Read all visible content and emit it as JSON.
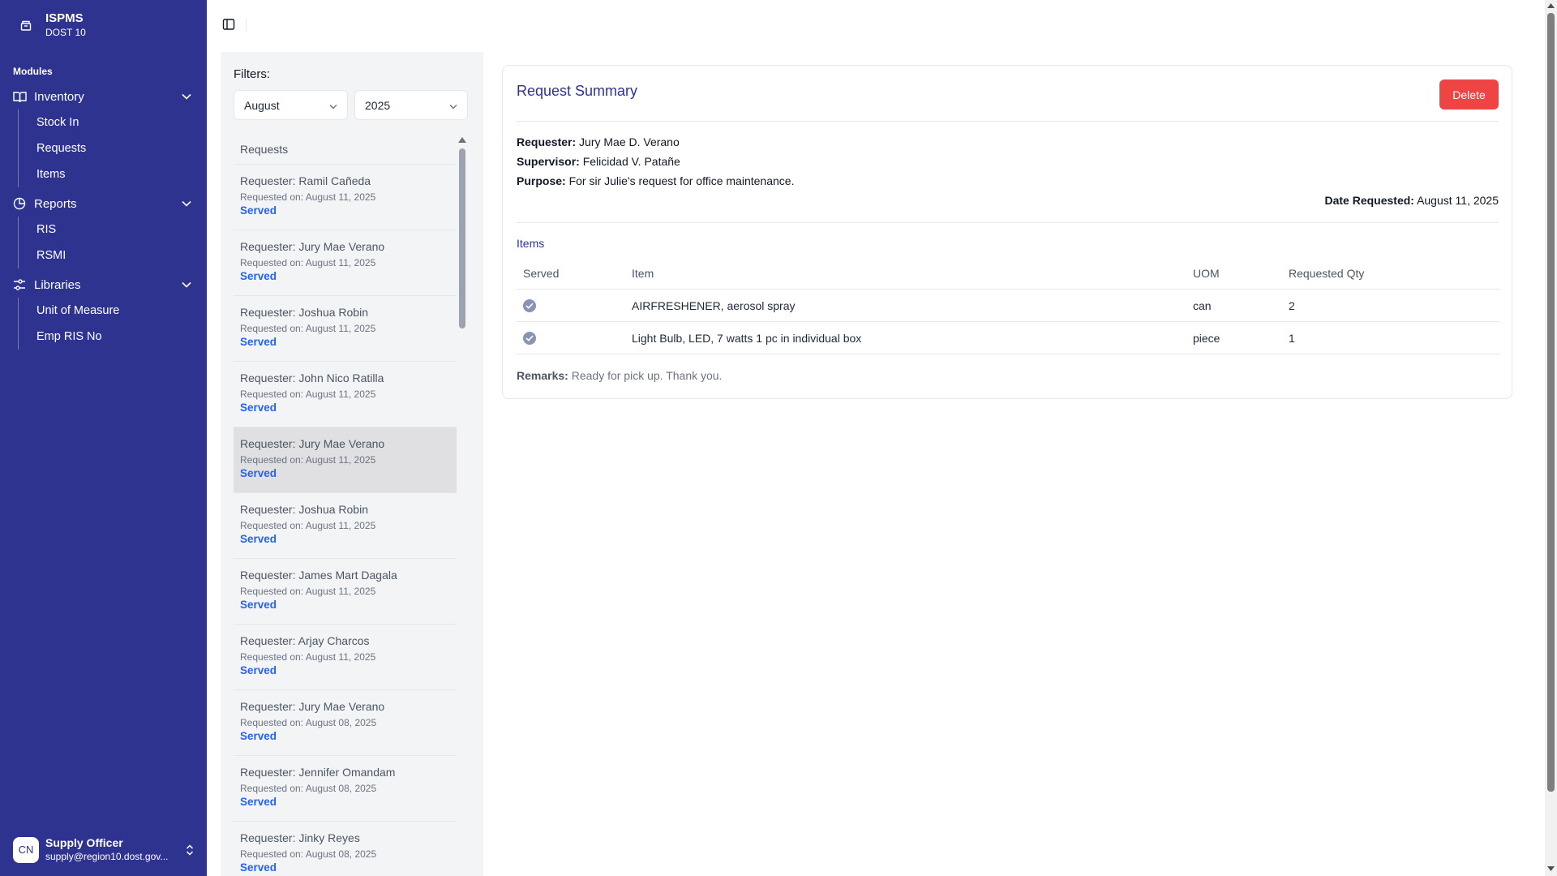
{
  "brand": {
    "title": "ISPMS",
    "subtitle": "DOST 10"
  },
  "sidebar": {
    "modules_label": "Modules",
    "groups": [
      {
        "label": "Inventory",
        "icon": "book-icon",
        "items": [
          "Stock In",
          "Requests",
          "Items"
        ]
      },
      {
        "label": "Reports",
        "icon": "pie-chart-icon",
        "items": [
          "RIS",
          "RSMI"
        ]
      },
      {
        "label": "Libraries",
        "icon": "sliders-icon",
        "items": [
          "Unit of Measure",
          "Emp RIS No"
        ]
      }
    ]
  },
  "user": {
    "initials": "CN",
    "name": "Supply Officer",
    "email": "supply@region10.dost.gov..."
  },
  "filters": {
    "label": "Filters:",
    "month": "August",
    "year": "2025"
  },
  "requests": {
    "header": "Requests",
    "items": [
      {
        "requester": "Requester: Ramil Cañeda",
        "date": "Requested on: August 11, 2025",
        "status": "Served"
      },
      {
        "requester": "Requester: Jury Mae Verano",
        "date": "Requested on: August 11, 2025",
        "status": "Served"
      },
      {
        "requester": "Requester: Joshua Robin",
        "date": "Requested on: August 11, 2025",
        "status": "Served"
      },
      {
        "requester": "Requester: John Nico Ratilla",
        "date": "Requested on: August 11, 2025",
        "status": "Served"
      },
      {
        "requester": "Requester: Jury Mae Verano",
        "date": "Requested on: August 11, 2025",
        "status": "Served"
      },
      {
        "requester": "Requester: Joshua Robin",
        "date": "Requested on: August 11, 2025",
        "status": "Served"
      },
      {
        "requester": "Requester: James Mart Dagala",
        "date": "Requested on: August 11, 2025",
        "status": "Served"
      },
      {
        "requester": "Requester: Arjay Charcos",
        "date": "Requested on: August 11, 2025",
        "status": "Served"
      },
      {
        "requester": "Requester: Jury Mae Verano",
        "date": "Requested on: August 08, 2025",
        "status": "Served"
      },
      {
        "requester": "Requester: Jennifer Omandam",
        "date": "Requested on: August 08, 2025",
        "status": "Served"
      },
      {
        "requester": "Requester: Jinky Reyes",
        "date": "Requested on: August 08, 2025",
        "status": "Served"
      }
    ]
  },
  "summary": {
    "title": "Request Summary",
    "delete_label": "Delete",
    "requester_label": "Requester:",
    "requester": "Jury Mae D. Verano",
    "supervisor_label": "Supervisor:",
    "supervisor": "Felicidad V. Patañe",
    "purpose_label": "Purpose:",
    "purpose": "For sir Julie's request for office maintenance.",
    "date_label": "Date Requested:",
    "date": "August 11, 2025",
    "items_label": "Items",
    "columns": [
      "Served",
      "Item",
      "UOM",
      "Requested Qty"
    ],
    "rows": [
      {
        "served": true,
        "item": "AIRFRESHENER, aerosol spray",
        "uom": "can",
        "qty": "2"
      },
      {
        "served": true,
        "item": "Light Bulb, LED, 7 watts 1 pc in individual box",
        "uom": "piece",
        "qty": "1"
      }
    ],
    "remarks_label": "Remarks:",
    "remarks": "Ready for pick up. Thank you."
  }
}
